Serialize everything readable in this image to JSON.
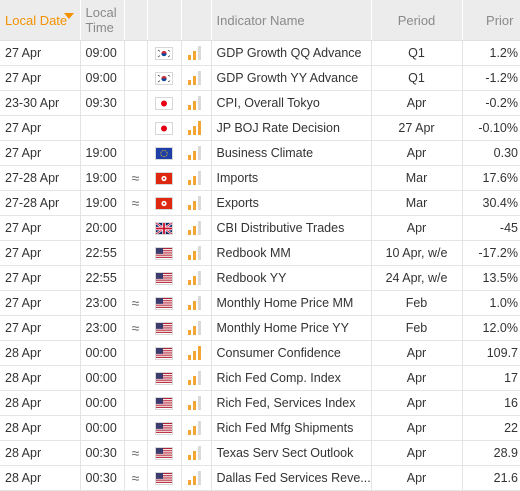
{
  "header": {
    "local_date": "Local Date",
    "local_time": "Local Time",
    "indicator_name": "Indicator Name",
    "period": "Period",
    "prior": "Prior"
  },
  "colors": {
    "accent": "#f39200",
    "header_bg": "#ececec"
  },
  "rows": [
    {
      "date": "27 Apr",
      "time": "09:00",
      "approx": "",
      "flag": "kr",
      "importance": "medium",
      "name": "GDP Growth QQ Advance",
      "period": "Q1",
      "prior": "1.2%"
    },
    {
      "date": "27 Apr",
      "time": "09:00",
      "approx": "",
      "flag": "kr",
      "importance": "medium",
      "name": "GDP Growth YY Advance",
      "period": "Q1",
      "prior": "-1.2%"
    },
    {
      "date": "23-30 Apr",
      "time": "09:30",
      "approx": "",
      "flag": "jp",
      "importance": "medium",
      "name": "CPI, Overall Tokyo",
      "period": "Apr",
      "prior": "-0.2%"
    },
    {
      "date": "27 Apr",
      "time": "",
      "approx": "",
      "flag": "jp",
      "importance": "high",
      "name": "JP BOJ Rate Decision",
      "period": "27 Apr",
      "prior": "-0.10%"
    },
    {
      "date": "27 Apr",
      "time": "19:00",
      "approx": "",
      "flag": "eu",
      "importance": "medium",
      "name": "Business Climate",
      "period": "Apr",
      "prior": "0.30"
    },
    {
      "date": "27-28 Apr",
      "time": "19:00",
      "approx": "≈",
      "flag": "hk",
      "importance": "medium",
      "name": "Imports",
      "period": "Mar",
      "prior": "17.6%"
    },
    {
      "date": "27-28 Apr",
      "time": "19:00",
      "approx": "≈",
      "flag": "hk",
      "importance": "medium",
      "name": "Exports",
      "period": "Mar",
      "prior": "30.4%"
    },
    {
      "date": "27 Apr",
      "time": "20:00",
      "approx": "",
      "flag": "gb",
      "importance": "medium",
      "name": "CBI Distributive Trades",
      "period": "Apr",
      "prior": "-45"
    },
    {
      "date": "27 Apr",
      "time": "22:55",
      "approx": "",
      "flag": "us",
      "importance": "medium",
      "name": "Redbook MM",
      "period": "10 Apr, w/e",
      "prior": "-17.2%"
    },
    {
      "date": "27 Apr",
      "time": "22:55",
      "approx": "",
      "flag": "us",
      "importance": "medium",
      "name": "Redbook YY",
      "period": "24 Apr, w/e",
      "prior": "13.5%"
    },
    {
      "date": "27 Apr",
      "time": "23:00",
      "approx": "≈",
      "flag": "us",
      "importance": "medium",
      "name": "Monthly Home Price MM",
      "period": "Feb",
      "prior": "1.0%"
    },
    {
      "date": "27 Apr",
      "time": "23:00",
      "approx": "≈",
      "flag": "us",
      "importance": "medium",
      "name": "Monthly Home Price YY",
      "period": "Feb",
      "prior": "12.0%"
    },
    {
      "date": "28 Apr",
      "time": "00:00",
      "approx": "",
      "flag": "us",
      "importance": "high",
      "name": "Consumer Confidence",
      "period": "Apr",
      "prior": "109.7"
    },
    {
      "date": "28 Apr",
      "time": "00:00",
      "approx": "",
      "flag": "us",
      "importance": "medium",
      "name": "Rich Fed Comp. Index",
      "period": "Apr",
      "prior": "17"
    },
    {
      "date": "28 Apr",
      "time": "00:00",
      "approx": "",
      "flag": "us",
      "importance": "medium",
      "name": "Rich Fed, Services Index",
      "period": "Apr",
      "prior": "16"
    },
    {
      "date": "28 Apr",
      "time": "00:00",
      "approx": "",
      "flag": "us",
      "importance": "medium",
      "name": "Rich Fed Mfg Shipments",
      "period": "Apr",
      "prior": "22"
    },
    {
      "date": "28 Apr",
      "time": "00:30",
      "approx": "≈",
      "flag": "us",
      "importance": "medium",
      "name": "Texas Serv Sect Outlook",
      "period": "Apr",
      "prior": "28.9"
    },
    {
      "date": "28 Apr",
      "time": "00:30",
      "approx": "≈",
      "flag": "us",
      "importance": "medium",
      "name": "Dallas Fed Services Reve...",
      "period": "Apr",
      "prior": "21.6"
    }
  ]
}
